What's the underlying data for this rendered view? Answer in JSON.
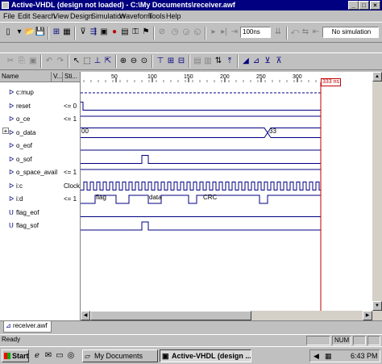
{
  "window": {
    "title": "Active-VHDL (design not loaded) - C:\\My Documents\\receiver.awf"
  },
  "menu": [
    "File",
    "Edit",
    "Search",
    "View",
    "Design",
    "Simulation",
    "Waveform",
    "Tools",
    "Help"
  ],
  "toolbar": {
    "sim_time_value": "100ns",
    "status_field": "No simulation",
    "icons_row1": [
      "new-icon",
      "open-icon",
      "save-icon",
      "print-icon",
      "tree-icon",
      "grid-icon",
      "funnel-icon",
      "compile-icon",
      "chip-icon",
      "record-icon",
      "library-icon",
      "key-icon",
      "stop-icon",
      "run-icon",
      "run-until-icon",
      "step-icon",
      "restart-icon",
      "play-icon",
      "run-for-icon",
      "step-over-icon",
      "step-into-icon",
      "break-icon",
      "watch-icon",
      "end-icon"
    ],
    "icons_row2": [
      "cut-icon",
      "copy-icon",
      "paste-icon",
      "undo-icon",
      "redo-icon",
      "pointer-icon",
      "select-icon",
      "insert-icon",
      "measure-icon",
      "zoom-in-icon",
      "zoom-out-icon",
      "zoom-fit-icon",
      "signal-add-icon",
      "bus-icon",
      "trace-icon",
      "edit-icon",
      "delete-icon",
      "force-icon",
      "stimulator-icon",
      "cursor-icon",
      "bookmark-icon",
      "find-icon"
    ]
  },
  "columns": {
    "name": "Name",
    "value": "V...",
    "stimulator": "Sti..."
  },
  "timeline": {
    "ticks": [
      "50",
      "100",
      "150",
      "200",
      "250",
      "300"
    ],
    "cursor_label": "333 ns"
  },
  "signals": [
    {
      "icon": "ᐅ",
      "name": "c:mup",
      "value": ""
    },
    {
      "icon": "ᐅ",
      "name": "reset",
      "value": "<= 0"
    },
    {
      "icon": "ᐅ",
      "name": "o_ce",
      "value": "<= 1"
    },
    {
      "icon": "ᐅ",
      "name": "o_data",
      "value": ""
    },
    {
      "icon": "ᐅ",
      "name": "o_eof",
      "value": ""
    },
    {
      "icon": "ᐅ",
      "name": "o_sof",
      "value": ""
    },
    {
      "icon": "ᐅ",
      "name": "o_space_avail",
      "value": "<= 1"
    },
    {
      "icon": "ᐅ",
      "name": "i:c",
      "value": "Clock"
    },
    {
      "icon": "ᐅ",
      "name": "i:d",
      "value": "<= 1"
    },
    {
      "icon": "ᑌ",
      "name": "flag_eof",
      "value": ""
    },
    {
      "icon": "ᑌ",
      "name": "flag_sof",
      "value": ""
    }
  ],
  "wave_labels": {
    "data_start": "00",
    "data_end": "33",
    "flag": "flag",
    "data": "data",
    "crc": "CRC"
  },
  "tab": {
    "label": "receiver.awf"
  },
  "statusbar": {
    "left": "Ready",
    "num": "NUM"
  },
  "taskbar": {
    "start": "Start",
    "tasks": [
      "My Documents",
      "Active-VHDL (design ..."
    ],
    "clock": "6:43 PM"
  },
  "colors": {
    "title_bg": "#000080",
    "wave": "#000080",
    "cursor": "#c00000"
  }
}
